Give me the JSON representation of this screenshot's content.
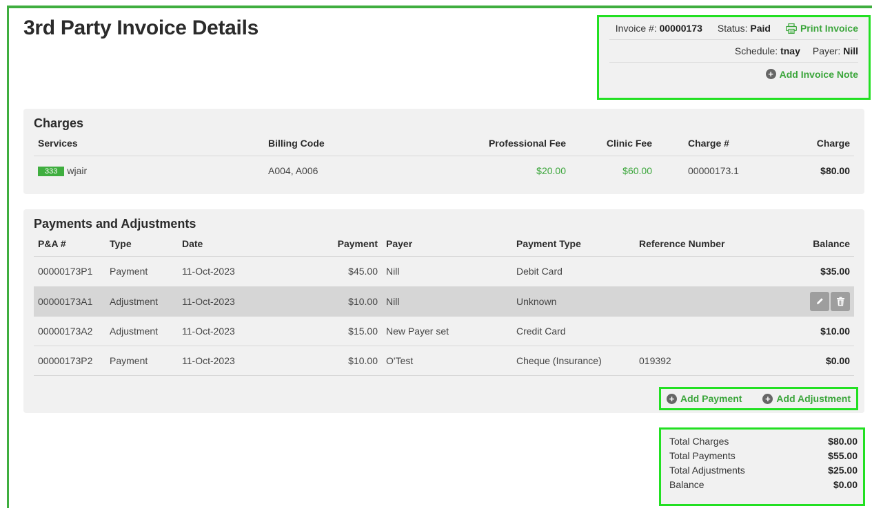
{
  "page_title": "3rd Party Invoice Details",
  "invoice_box": {
    "invoice_label": "Invoice #:",
    "invoice_number": "00000173",
    "status_label": "Status:",
    "status_value": "Paid",
    "print_label": "Print Invoice",
    "schedule_label": "Schedule:",
    "schedule_value": "tnay",
    "payer_label": "Payer:",
    "payer_value": "Nill",
    "add_note_label": "Add Invoice Note"
  },
  "charges": {
    "title": "Charges",
    "headers": {
      "services": "Services",
      "billing_code": "Billing Code",
      "professional_fee": "Professional Fee",
      "clinic_fee": "Clinic Fee",
      "charge_num": "Charge #",
      "charge": "Charge"
    },
    "rows": [
      {
        "tag": "333",
        "service": "wjair",
        "billing_code": "A004, A006",
        "professional_fee": "$20.00",
        "clinic_fee": "$60.00",
        "charge_num": "00000173.1",
        "charge": "$80.00"
      }
    ]
  },
  "payments": {
    "title": "Payments and Adjustments",
    "headers": {
      "pa_num": "P&A #",
      "type": "Type",
      "date": "Date",
      "payment": "Payment",
      "payer": "Payer",
      "payment_type": "Payment Type",
      "reference": "Reference Number",
      "balance": "Balance"
    },
    "rows": [
      {
        "pa_num": "00000173P1",
        "type": "Payment",
        "date": "11-Oct-2023",
        "payment": "$45.00",
        "payer": "Nill",
        "payment_type": "Debit Card",
        "reference": "",
        "balance": "$35.00"
      },
      {
        "pa_num": "00000173A1",
        "type": "Adjustment",
        "date": "11-Oct-2023",
        "payment": "$10.00",
        "payer": "Nill",
        "payment_type": "Unknown",
        "reference": "",
        "balance": ""
      },
      {
        "pa_num": "00000173A2",
        "type": "Adjustment",
        "date": "11-Oct-2023",
        "payment": "$15.00",
        "payer": "New Payer set",
        "payment_type": "Credit Card",
        "reference": "",
        "balance": "$10.00"
      },
      {
        "pa_num": "00000173P2",
        "type": "Payment",
        "date": "11-Oct-2023",
        "payment": "$10.00",
        "payer": "O'Test",
        "payment_type": "Cheque (Insurance)",
        "reference": "019392",
        "balance": "$0.00"
      }
    ],
    "add_payment_label": "Add Payment",
    "add_adjustment_label": "Add Adjustment"
  },
  "totals": {
    "total_charges_label": "Total Charges",
    "total_charges": "$80.00",
    "total_payments_label": "Total Payments",
    "total_payments": "$55.00",
    "total_adjustments_label": "Total Adjustments",
    "total_adjustments": "$25.00",
    "balance_label": "Balance",
    "balance": "$0.00"
  },
  "colors": {
    "accent_green": "#3aa53a",
    "highlight_border": "#22e022",
    "panel_bg": "#f1f1f1"
  }
}
